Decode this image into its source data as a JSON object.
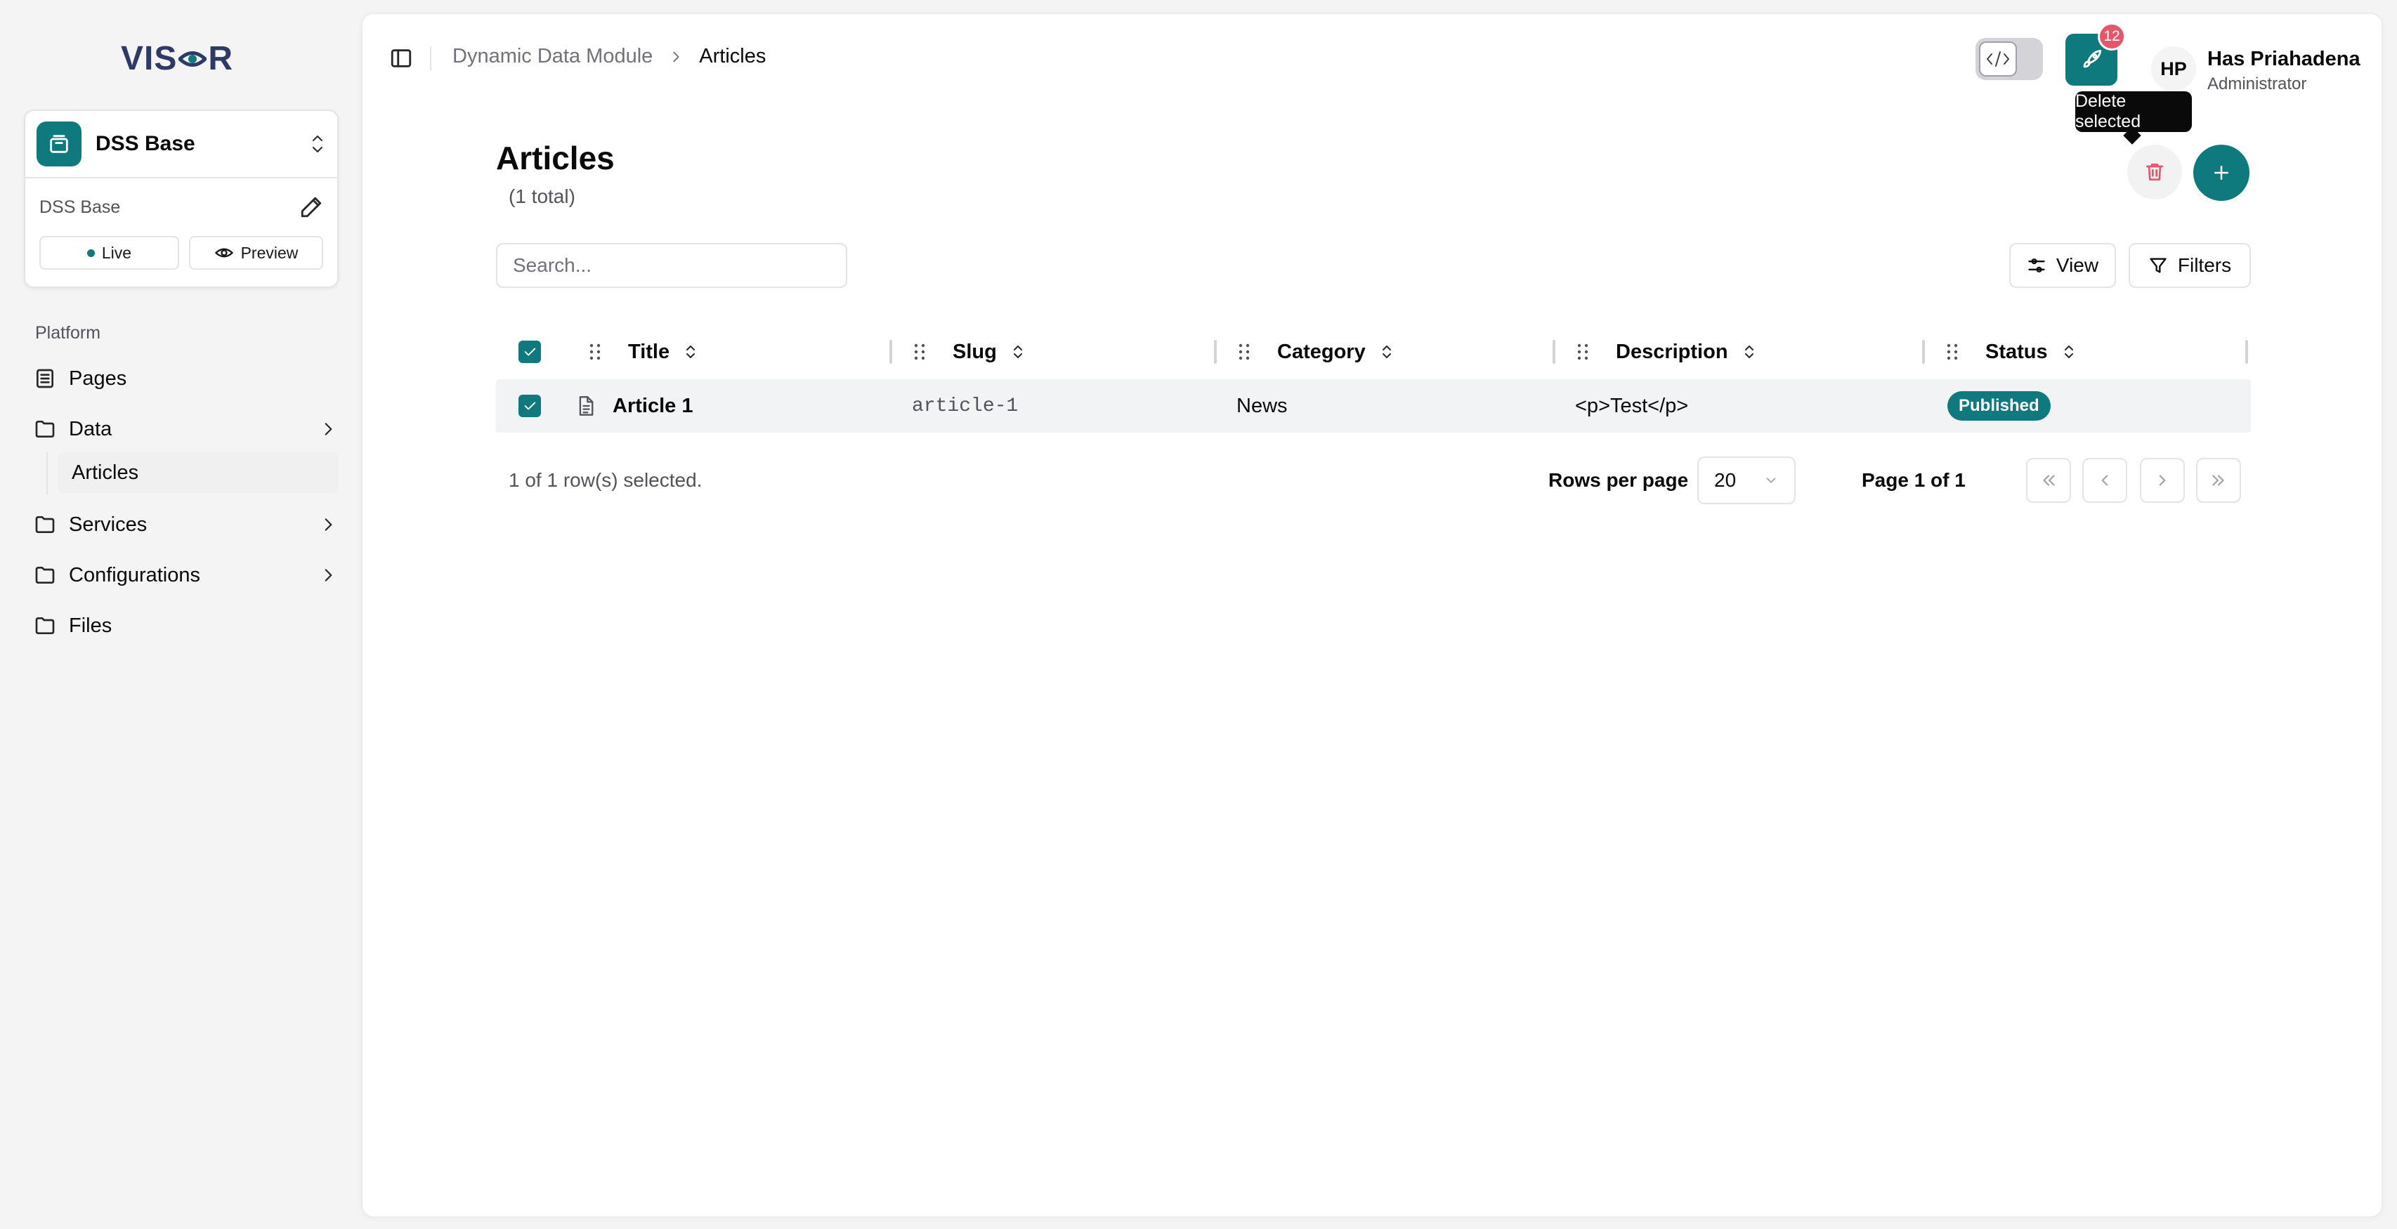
{
  "app": {
    "logo_text": "VIS",
    "logo_text_end": "R"
  },
  "environment": {
    "name": "DSS Base",
    "sub_label": "DSS Base",
    "live_label": "Live",
    "preview_label": "Preview"
  },
  "sidebar": {
    "section_label": "Platform",
    "items": [
      {
        "label": "Pages",
        "icon": "file-list-icon"
      },
      {
        "label": "Data",
        "icon": "folder-icon",
        "expanded": true,
        "children": [
          {
            "label": "Articles",
            "active": true
          }
        ]
      },
      {
        "label": "Services",
        "icon": "folder-icon"
      },
      {
        "label": "Configurations",
        "icon": "folder-icon"
      },
      {
        "label": "Files",
        "icon": "folder-icon"
      }
    ]
  },
  "header": {
    "breadcrumb": [
      "Dynamic Data Module",
      "Articles"
    ],
    "deploy_count": "12",
    "user": {
      "initials": "HP",
      "name": "Has Priahadena",
      "role": "Administrator"
    },
    "tooltip": "Delete selected"
  },
  "page": {
    "title": "Articles",
    "count_text": "(1 total)",
    "search_placeholder": "Search...",
    "view_label": "View",
    "filters_label": "Filters"
  },
  "table": {
    "columns": [
      "Title",
      "Slug",
      "Category",
      "Description",
      "Status"
    ],
    "rows": [
      {
        "selected": true,
        "title": "Article 1",
        "slug": "article-1",
        "category": "News",
        "description": "<p>Test</p>",
        "status": "Published"
      }
    ]
  },
  "footer": {
    "selection_text": "1 of 1 row(s) selected.",
    "rows_per_page_label": "Rows per page",
    "rows_per_page_value": "20",
    "page_info": "Page 1 of 1"
  },
  "colors": {
    "accent": "#0f7a7e",
    "danger": "#e5566b",
    "row_selected_bg": "#f1f3f5"
  }
}
